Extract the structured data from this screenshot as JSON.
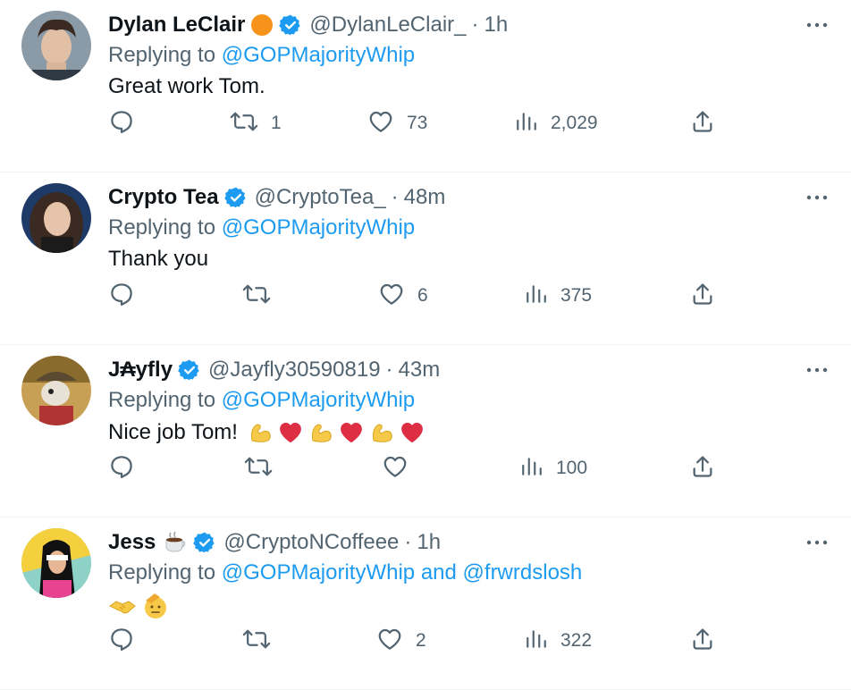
{
  "tweets": [
    {
      "name": "Dylan LeClair",
      "handle": "@DylanLeClair_",
      "time": "1h",
      "replying_label": "Replying to",
      "replying_to": "@GOPMajorityWhip",
      "replying_extra": "",
      "text": "Great work Tom.",
      "reply_count": "",
      "retweet_count": "1",
      "like_count": "73",
      "view_count": "2,029",
      "has_orange_badge": true,
      "emojis": []
    },
    {
      "name": "Crypto Tea",
      "handle": "@CryptoTea_",
      "time": "48m",
      "replying_label": "Replying to",
      "replying_to": "@GOPMajorityWhip",
      "replying_extra": "",
      "text": "Thank you",
      "reply_count": "",
      "retweet_count": "",
      "like_count": "6",
      "view_count": "375",
      "has_orange_badge": false,
      "emojis": []
    },
    {
      "name": "J₳yfly",
      "handle": "@Jayfly30590819",
      "time": "43m",
      "replying_label": "Replying to",
      "replying_to": "@GOPMajorityWhip",
      "replying_extra": "",
      "text": "Nice job Tom!",
      "reply_count": "",
      "retweet_count": "",
      "like_count": "",
      "view_count": "100",
      "has_orange_badge": false,
      "emojis": [
        "flexed-biceps",
        "red-heart",
        "flexed-biceps",
        "red-heart",
        "flexed-biceps",
        "red-heart"
      ]
    },
    {
      "name": "Jess",
      "handle": "@CryptoNCoffeee",
      "time": "1h",
      "replying_label": "Replying to",
      "replying_to": "@GOPMajorityWhip",
      "replying_extra": " and @frwrdslosh",
      "text": "",
      "reply_count": "",
      "retweet_count": "",
      "like_count": "2",
      "view_count": "322",
      "has_orange_badge": false,
      "emojis": [
        "handshake",
        "saluting-face"
      ]
    }
  ],
  "colors": {
    "link": "#1d9bf0",
    "muted": "#536471",
    "verified": "#1d9bf0",
    "divider": "#eff3f4"
  }
}
